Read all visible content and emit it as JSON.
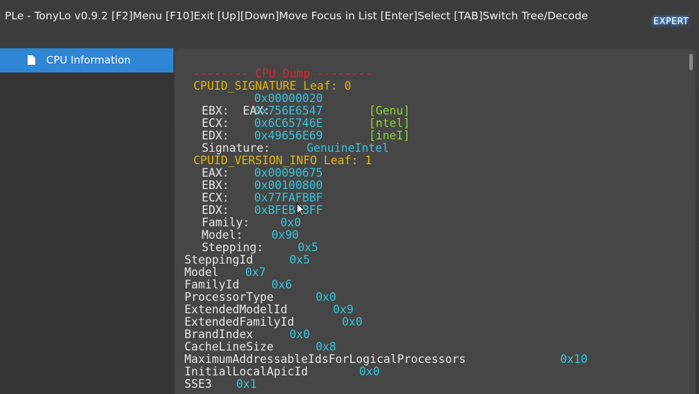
{
  "window": {
    "title": "PLe - TonyLo v0.9.2   [F2]Menu [F10]Exit [Up][Down]Move Focus in List [Enter]Select [TAB]Switch Tree/Decode",
    "mode_badge": "EXPERT"
  },
  "sidebar": {
    "items": [
      {
        "label": "CPU Information",
        "icon": "document-icon",
        "selected": true
      }
    ]
  },
  "colors": {
    "header_red": "#d9252b",
    "leaf_yellow": "#e3b511",
    "label_white": "#e8e8e8",
    "value_cyan": "#35c4dc",
    "ascii_green": "#8ed630",
    "selection_blue": "#2f86d4"
  },
  "dump": {
    "header": "-------- CPU Dump --------",
    "signature_leaf": "CPUID_SIGNATURE Leaf: 0",
    "sig_regs": [
      {
        "name": "EAX:",
        "value": "0x00000020",
        "ascii": ""
      },
      {
        "name": "EBX:",
        "value": "0x756E6547",
        "ascii": "[Genu]"
      },
      {
        "name": "ECX:",
        "value": "0x6C65746E",
        "ascii": "[ntel]"
      },
      {
        "name": "EDX:",
        "value": "0x49656E69",
        "ascii": "[ineI]"
      }
    ],
    "signature": {
      "label": "Signature:",
      "value": "GenuineIntel"
    },
    "version_leaf": "CPUID_VERSION_INFO Leaf: 1",
    "ver_regs": [
      {
        "name": "EAX:",
        "value": "0x00090675"
      },
      {
        "name": "EBX:",
        "value": "0x00100800"
      },
      {
        "name": "ECX:",
        "value": "0x77FAFBBF"
      },
      {
        "name": "EDX:",
        "value": "0xBFEBFBFF"
      }
    ],
    "ver_fields": [
      {
        "name": "Family:",
        "value": "0x0"
      },
      {
        "name": "Model:",
        "value": "0x90"
      },
      {
        "name": "Stepping:",
        "value": "0x5"
      }
    ],
    "decoded": [
      {
        "name": "SteppingId",
        "value": "0x5"
      },
      {
        "name": "Model",
        "value": "0x7"
      },
      {
        "name": "FamilyId",
        "value": "0x6"
      },
      {
        "name": "ProcessorType",
        "value": "0x0"
      },
      {
        "name": "ExtendedModelId",
        "value": "0x9"
      },
      {
        "name": "ExtendedFamilyId",
        "value": "0x0"
      },
      {
        "name": "BrandIndex",
        "value": "0x0"
      },
      {
        "name": "CacheLineSize",
        "value": "0x8"
      },
      {
        "name": "MaximumAddressableIdsForLogicalProcessors",
        "value": "0x10"
      },
      {
        "name": "InitialLocalApicId",
        "value": "0x0"
      },
      {
        "name": "SSE3",
        "value": "0x1"
      }
    ]
  }
}
